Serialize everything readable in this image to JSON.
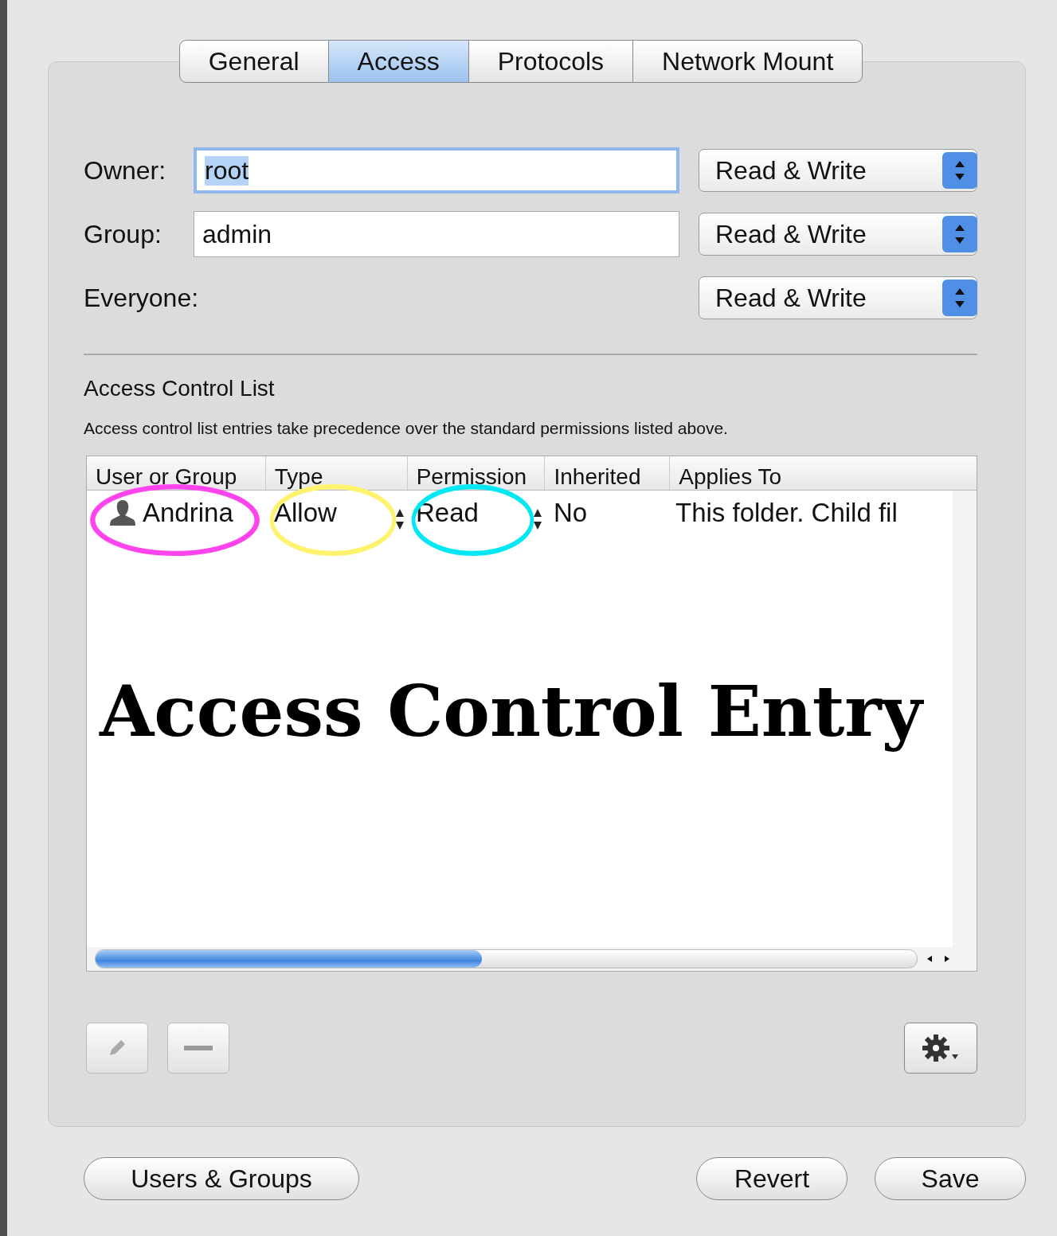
{
  "tabs": [
    {
      "label": "General",
      "selected": false
    },
    {
      "label": "Access",
      "selected": true
    },
    {
      "label": "Protocols",
      "selected": false
    },
    {
      "label": "Network Mount",
      "selected": false
    }
  ],
  "permissions": [
    {
      "label": "Owner:",
      "value": "root",
      "value_selected": true,
      "access": "Read & Write"
    },
    {
      "label": "Group:",
      "value": "admin",
      "value_selected": false,
      "access": "Read & Write"
    },
    {
      "label": "Everyone:",
      "access": "Read & Write"
    }
  ],
  "acl": {
    "title": "Access Control List",
    "description": "Access control list entries take precedence over the standard permissions listed above.",
    "columns": [
      "User or Group",
      "Type",
      "Permission",
      "Inherited",
      "Applies To"
    ],
    "rows": [
      {
        "cells": [
          {
            "text": "Andrina",
            "color": "#ff44ee"
          },
          {
            "text": "Allow",
            "color": "#fff36e"
          },
          {
            "text": "Read",
            "color": "#00e8f4"
          },
          {
            "text": "No"
          },
          {
            "text": "This folder. Child fil"
          }
        ]
      }
    ],
    "overlay_caption": "Access Control Entry"
  },
  "buttons": [
    "Users & Groups",
    "Revert",
    "Save"
  ]
}
